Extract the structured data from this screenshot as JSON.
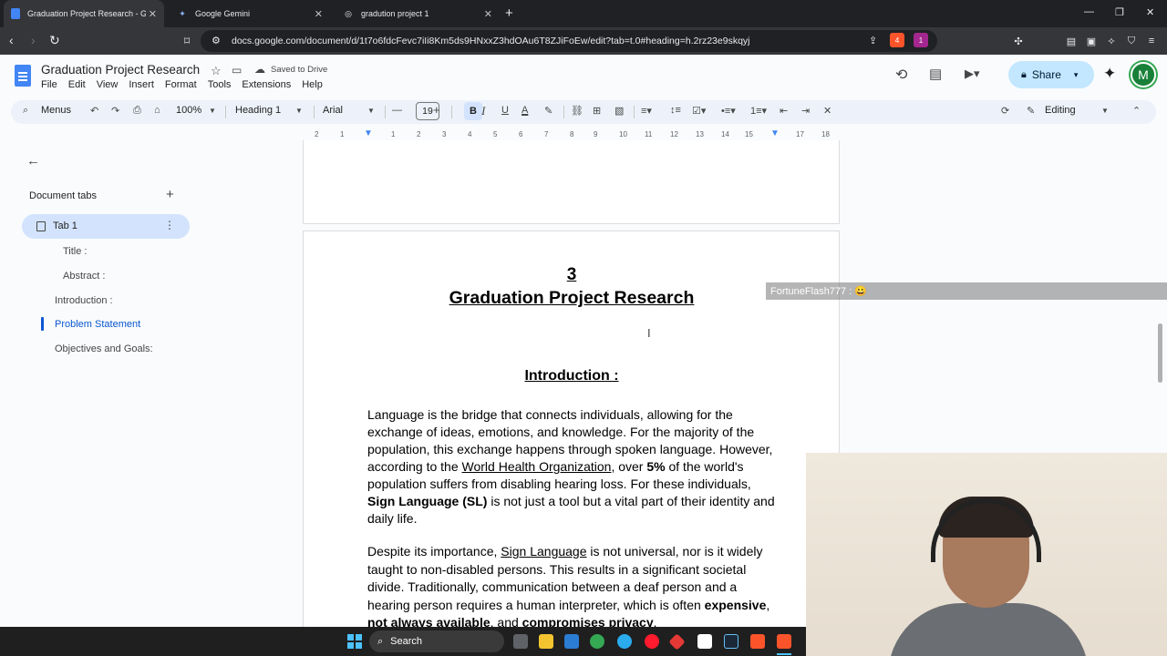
{
  "browser": {
    "tabs": [
      {
        "title": "Graduation Project Research - Goo",
        "icon": "docs-icon",
        "active": true
      },
      {
        "title": "Google Gemini",
        "icon": "gemini-icon",
        "active": false
      },
      {
        "title": "gradution project 1",
        "icon": "globe-icon",
        "active": false
      }
    ],
    "url": "docs.google.com/document/d/1t7o6fdcFevc7iIi8Km5ds9HNxxZ3hdOAu6T8ZJiFoEw/edit?tab=t.0#heading=h.2rz23e9skqyj",
    "badges": {
      "brave_shield": "4",
      "brave_rewards": "1"
    }
  },
  "docs": {
    "title": "Graduation Project Research",
    "saved_status": "Saved to Drive",
    "menu": [
      "File",
      "Edit",
      "View",
      "Insert",
      "Format",
      "Tools",
      "Extensions",
      "Help"
    ],
    "share_label": "Share",
    "avatar_letter": "M"
  },
  "toolbar": {
    "menus_label": "Menus",
    "zoom": "100%",
    "style": "Heading 1",
    "font": "Arial",
    "font_size": "19",
    "bold_label": "B",
    "italic_label": "I",
    "underline_label": "U",
    "text_color_label": "A",
    "mode": "Editing"
  },
  "sidebar": {
    "header": "Document tabs",
    "tab_name": "Tab 1",
    "outline": [
      {
        "label": "Title :",
        "active": false
      },
      {
        "label": "Abstract :",
        "active": false
      },
      {
        "label": "Introduction :",
        "active": false
      },
      {
        "label": "Problem Statement",
        "active": true
      },
      {
        "label": "Objectives and Goals:",
        "active": false
      }
    ]
  },
  "ruler": {
    "ticks": [
      "2",
      "1",
      "1",
      "2",
      "3",
      "4",
      "5",
      "6",
      "7",
      "8",
      "9",
      "10",
      "11",
      "12",
      "13",
      "14",
      "15",
      "16",
      "17",
      "18"
    ]
  },
  "document": {
    "page_number": "3",
    "heading": "Graduation Project Research",
    "section_title": "Introduction :",
    "p1": {
      "a": "Language is the bridge that connects individuals, allowing for the exchange of ideas, emotions, and knowledge. For the majority of the population, this exchange happens through spoken language. However, according to the ",
      "link": "World Health Organization",
      "b": ", over ",
      "bold1": "5%",
      "c": " of the world's population suffers from disabling hearing loss. For these individuals, ",
      "bold2": "Sign Language (SL)",
      "d": " is not just a tool but a vital part of their identity and daily life."
    },
    "p2": {
      "a": "Despite its importance, ",
      "link": "Sign Language",
      "b": " is not universal, nor is it widely taught to non-disabled persons. This results in a significant societal divide. Traditionally, communication between a deaf person and a hearing person requires a human interpreter, which is often ",
      "bold1": "expensive",
      "sep1": ", ",
      "bold2": "not always available",
      "sep2": ", and ",
      "bold3": "compromises privacy",
      "end": "."
    }
  },
  "overlay": {
    "chat_message": "FortuneFlash777 :  😀"
  },
  "taskbar": {
    "search_label": "Search"
  }
}
